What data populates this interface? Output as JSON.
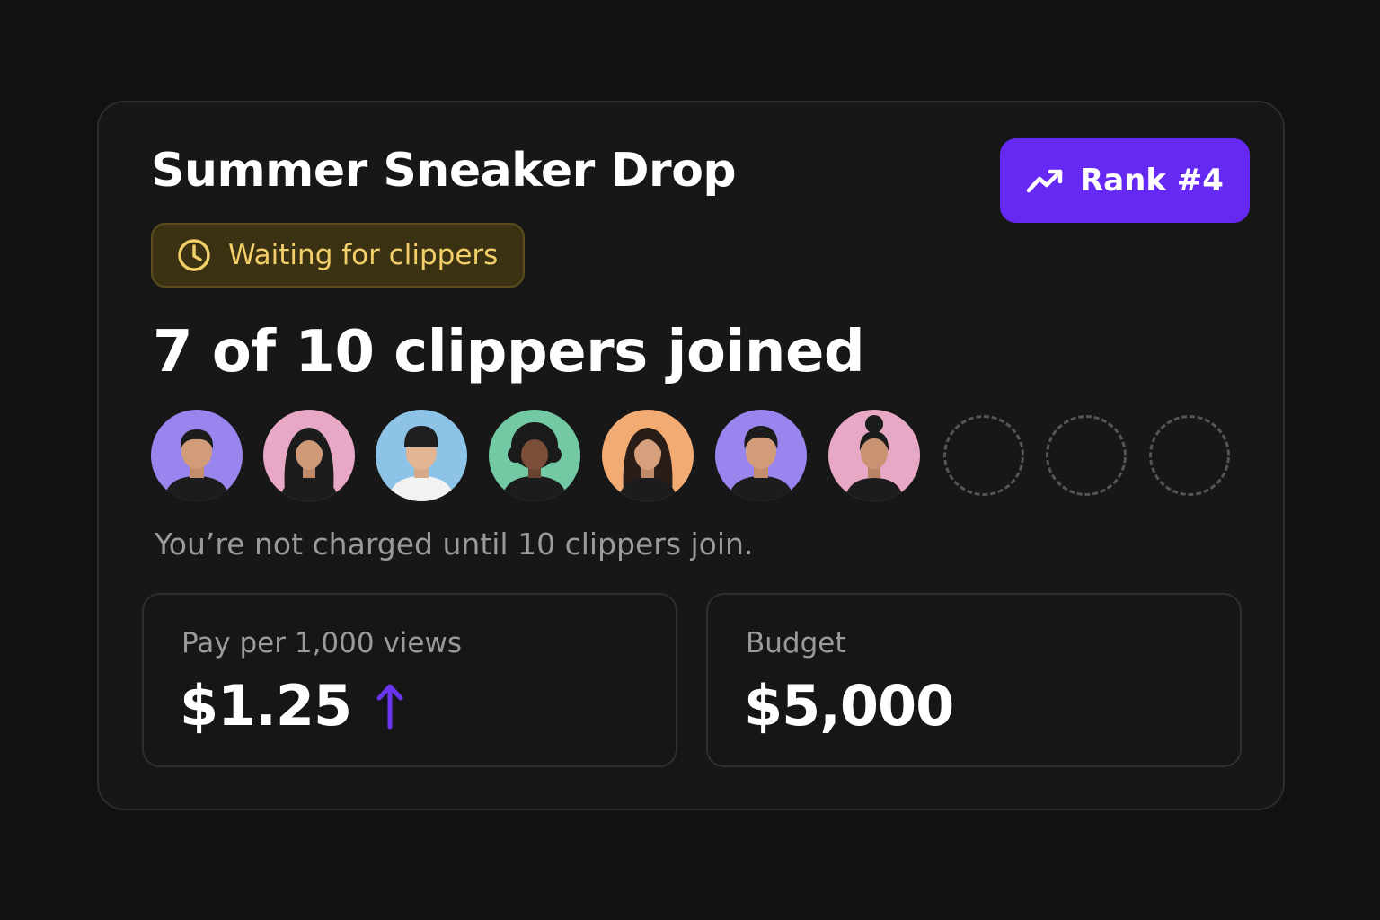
{
  "campaign": {
    "title": "Summer Sneaker Drop",
    "status": "Waiting for clippers",
    "rank_label": "Rank #4",
    "joined_text": "7 of 10 clippers joined",
    "clippers_joined": 7,
    "clippers_required": 10,
    "note": "You’re not charged until 10 clippers join."
  },
  "stats": {
    "pay": {
      "label": "Pay per 1,000 views",
      "value": "$1.25",
      "trend_icon": "arrow-up-icon"
    },
    "budget": {
      "label": "Budget",
      "value": "$5,000"
    }
  },
  "colors": {
    "accent": "#6629f3",
    "status_text": "#f3cf6a",
    "status_bg": "#3b3113"
  },
  "icons": {
    "rank": "trending-up-icon",
    "status": "clock-icon"
  }
}
